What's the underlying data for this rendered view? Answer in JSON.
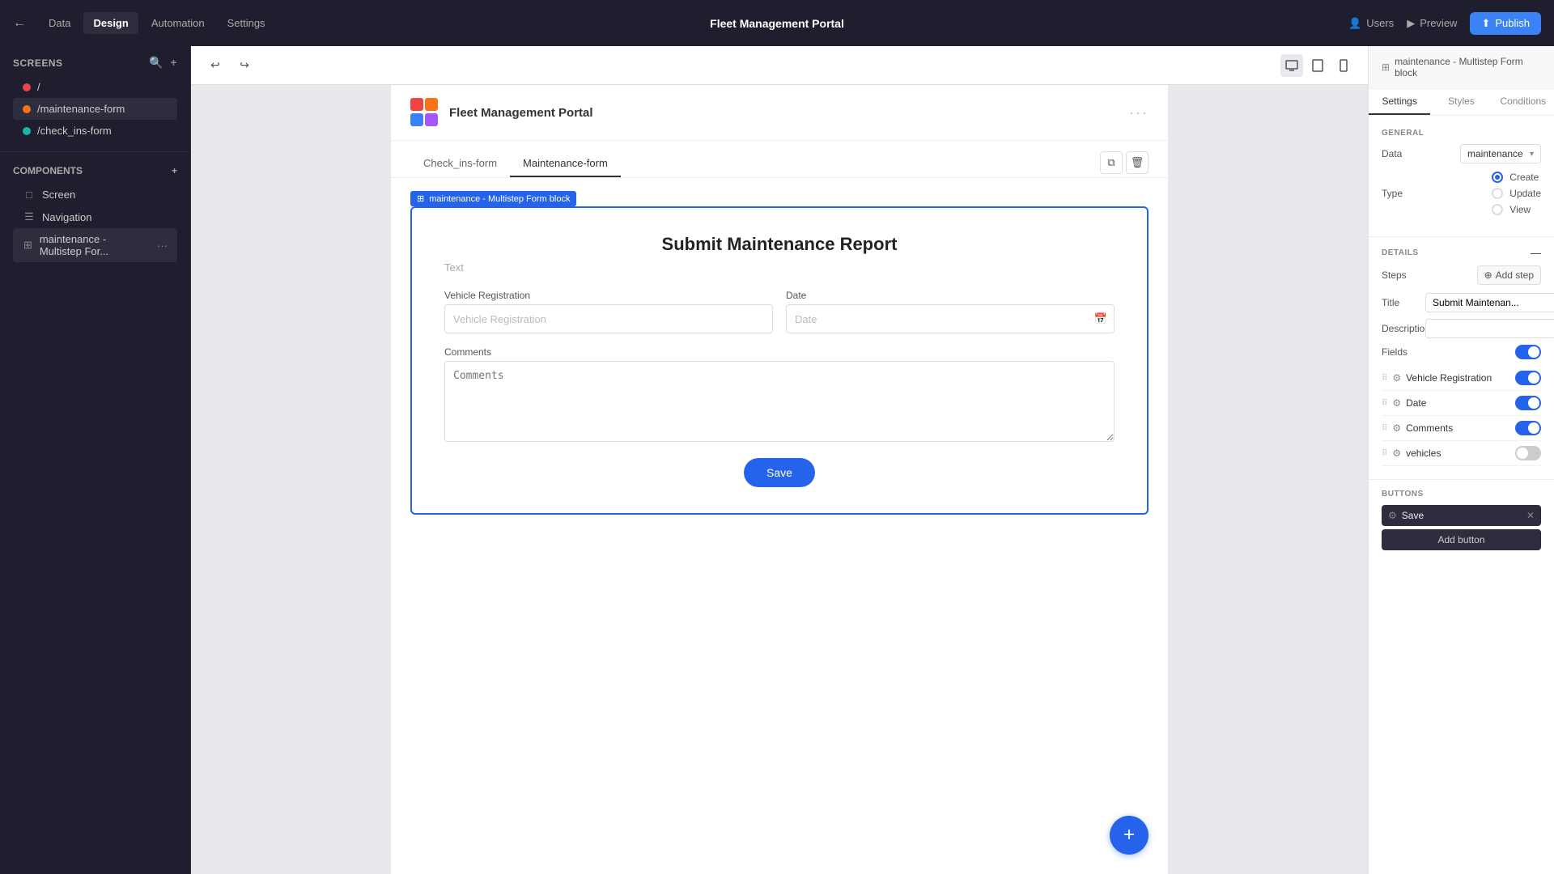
{
  "topNav": {
    "backLabel": "←",
    "tabs": [
      {
        "id": "data",
        "label": "Data"
      },
      {
        "id": "design",
        "label": "Design"
      },
      {
        "id": "automation",
        "label": "Automation"
      },
      {
        "id": "settings",
        "label": "Settings"
      }
    ],
    "activeTab": "design",
    "title": "Fleet Management Portal",
    "actions": {
      "users": "Users",
      "preview": "Preview",
      "publish": "Publish"
    }
  },
  "leftSidebar": {
    "screensLabel": "Screens",
    "screens": [
      {
        "id": "root",
        "label": "/",
        "color": "red"
      },
      {
        "id": "maintenance-form",
        "label": "/maintenance-form",
        "color": "orange",
        "active": true
      },
      {
        "id": "check-ins-form",
        "label": "/check_ins-form",
        "color": "teal"
      }
    ],
    "componentsLabel": "Components",
    "components": [
      {
        "id": "screen",
        "label": "Screen",
        "icon": "□"
      },
      {
        "id": "navigation",
        "label": "Navigation",
        "icon": "☰"
      },
      {
        "id": "form-block",
        "label": "maintenance - Multistep For...",
        "icon": "⊞",
        "active": true,
        "hasMenu": true
      }
    ]
  },
  "canvasToolbar": {
    "undo": "↩",
    "redo": "↪",
    "viewButtons": [
      {
        "id": "desktop",
        "icon": "⬜",
        "active": true
      },
      {
        "id": "tablet",
        "icon": "▭"
      },
      {
        "id": "mobile",
        "icon": "▯"
      }
    ]
  },
  "appPreview": {
    "logo": "Fleet Management Portal",
    "tabs": [
      {
        "id": "check-ins",
        "label": "Check_ins-form"
      },
      {
        "id": "maintenance",
        "label": "Maintenance-form",
        "active": true
      }
    ],
    "formBlock": {
      "label": "maintenance - Multistep Form block",
      "form": {
        "title": "Submit Maintenance Report",
        "subtitle": "Text",
        "fields": [
          {
            "id": "vehicle-reg",
            "label": "Vehicle Registration",
            "placeholder": "Vehicle Registration",
            "type": "text"
          },
          {
            "id": "date",
            "label": "Date",
            "placeholder": "Date",
            "type": "date"
          },
          {
            "id": "comments",
            "label": "Comments",
            "placeholder": "Comments",
            "type": "textarea"
          }
        ],
        "saveButton": "Save"
      }
    },
    "fabButton": "+"
  },
  "rightPanel": {
    "headerLabel": "maintenance - Multistep Form block",
    "tabs": [
      {
        "id": "settings",
        "label": "Settings",
        "active": true
      },
      {
        "id": "styles",
        "label": "Styles"
      },
      {
        "id": "conditions",
        "label": "Conditions"
      }
    ],
    "general": {
      "title": "GENERAL",
      "dataLabel": "Data",
      "dataValue": "maintenance",
      "typeLabel": "Type",
      "typeOptions": [
        {
          "id": "create",
          "label": "Create",
          "checked": true
        },
        {
          "id": "update",
          "label": "Update",
          "checked": false
        },
        {
          "id": "view",
          "label": "View",
          "checked": false
        }
      ]
    },
    "details": {
      "title": "DETAILS",
      "stepsLabel": "Steps",
      "addStepLabel": "Add step",
      "titleLabel": "Title",
      "titleValue": "Submit Maintenan...",
      "descriptionLabel": "Description",
      "fieldsLabel": "Fields",
      "fields": [
        {
          "id": "vehicle-reg",
          "name": "Vehicle Registration",
          "enabled": true
        },
        {
          "id": "date",
          "name": "Date",
          "enabled": true
        },
        {
          "id": "comments",
          "name": "Comments",
          "enabled": true
        },
        {
          "id": "vehicles",
          "name": "vehicles",
          "enabled": false
        }
      ]
    },
    "buttons": {
      "title": "Buttons",
      "items": [
        {
          "id": "save",
          "name": "Save"
        }
      ],
      "addButtonLabel": "Add button"
    }
  }
}
